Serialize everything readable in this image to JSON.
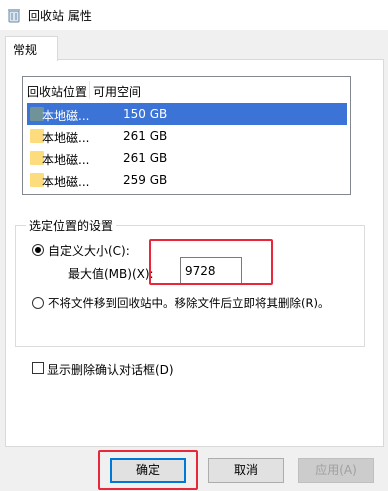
{
  "window": {
    "title": "回收站 属性",
    "icon": "recycle-bin-icon"
  },
  "tabs": [
    {
      "label": "常规",
      "active": true
    }
  ],
  "locations": {
    "columns": [
      "回收站位置",
      "可用空间"
    ],
    "rows": [
      {
        "name": "本地磁...",
        "size": "150 GB",
        "selected": true
      },
      {
        "name": "本地磁...",
        "size": "261 GB",
        "selected": false
      },
      {
        "name": "本地磁...",
        "size": "261 GB",
        "selected": false
      },
      {
        "name": "本地磁...",
        "size": "259 GB",
        "selected": false
      }
    ]
  },
  "settings": {
    "group_label": "选定位置的设置",
    "custom_size_label": "自定义大小(C):",
    "custom_size_checked": true,
    "max_size_label": "最大值(MB)(X):",
    "max_size_value": "9728",
    "no_recycle_label": "不将文件移到回收站中。移除文件后立即将其删除(R)。",
    "no_recycle_checked": false
  },
  "confirm_delete": {
    "label": "显示删除确认对话框(D)",
    "checked": false
  },
  "buttons": {
    "ok": "确定",
    "cancel": "取消",
    "apply": "应用(A)"
  },
  "colors": {
    "selection": "#3b73d6",
    "highlight": "#e8283a",
    "default_button_border": "#0078d7"
  }
}
